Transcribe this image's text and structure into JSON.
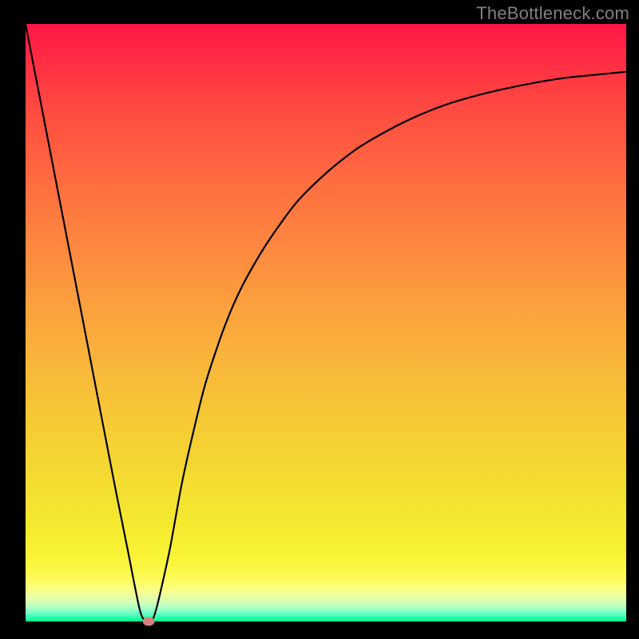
{
  "watermark": "TheBottleneck.com",
  "chart_data": {
    "type": "line",
    "title": "",
    "xlabel": "",
    "ylabel": "",
    "xlim": [
      0,
      100
    ],
    "ylim": [
      0,
      100
    ],
    "grid": false,
    "legend": false,
    "series": [
      {
        "name": "bottleneck-curve",
        "x": [
          0,
          5,
          10,
          15,
          17,
          19,
          20,
          21,
          22,
          24,
          26,
          28,
          30,
          33,
          36,
          40,
          45,
          50,
          55,
          60,
          65,
          70,
          75,
          80,
          85,
          90,
          95,
          100
        ],
        "values": [
          100,
          74,
          48,
          22,
          12,
          2,
          0,
          0,
          3,
          12,
          23,
          32,
          40,
          49,
          56,
          63,
          70,
          75,
          79,
          82,
          84.5,
          86.5,
          88,
          89.2,
          90.2,
          91,
          91.5,
          92
        ]
      }
    ],
    "marker": {
      "x": 20.5,
      "y": 0,
      "color": "#d6837f"
    },
    "background_gradient": {
      "top": "#ff1646",
      "mid": "#f5d034",
      "bottom": "#01ff86"
    }
  }
}
